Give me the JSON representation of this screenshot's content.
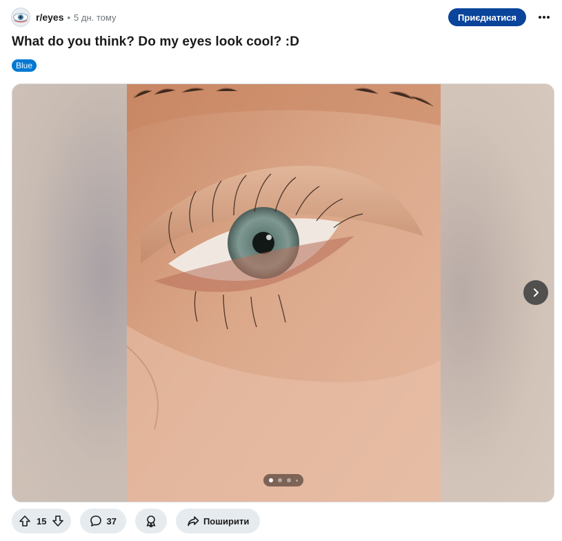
{
  "post": {
    "subreddit": "r/eyes",
    "separator": "•",
    "time": "5 дн. тому",
    "join_label": "Приєднатися",
    "title": "What do you think? Do my eyes look cool? :D",
    "flair": "Blue"
  },
  "gallery": {
    "image_count": 4,
    "current_index": 1
  },
  "actions": {
    "upvotes": "15",
    "comments": "37",
    "share_label": "Поширити"
  },
  "colors": {
    "join_button": "#0a449b",
    "flair": "#0079d3",
    "action_pill": "#e5ebee"
  }
}
